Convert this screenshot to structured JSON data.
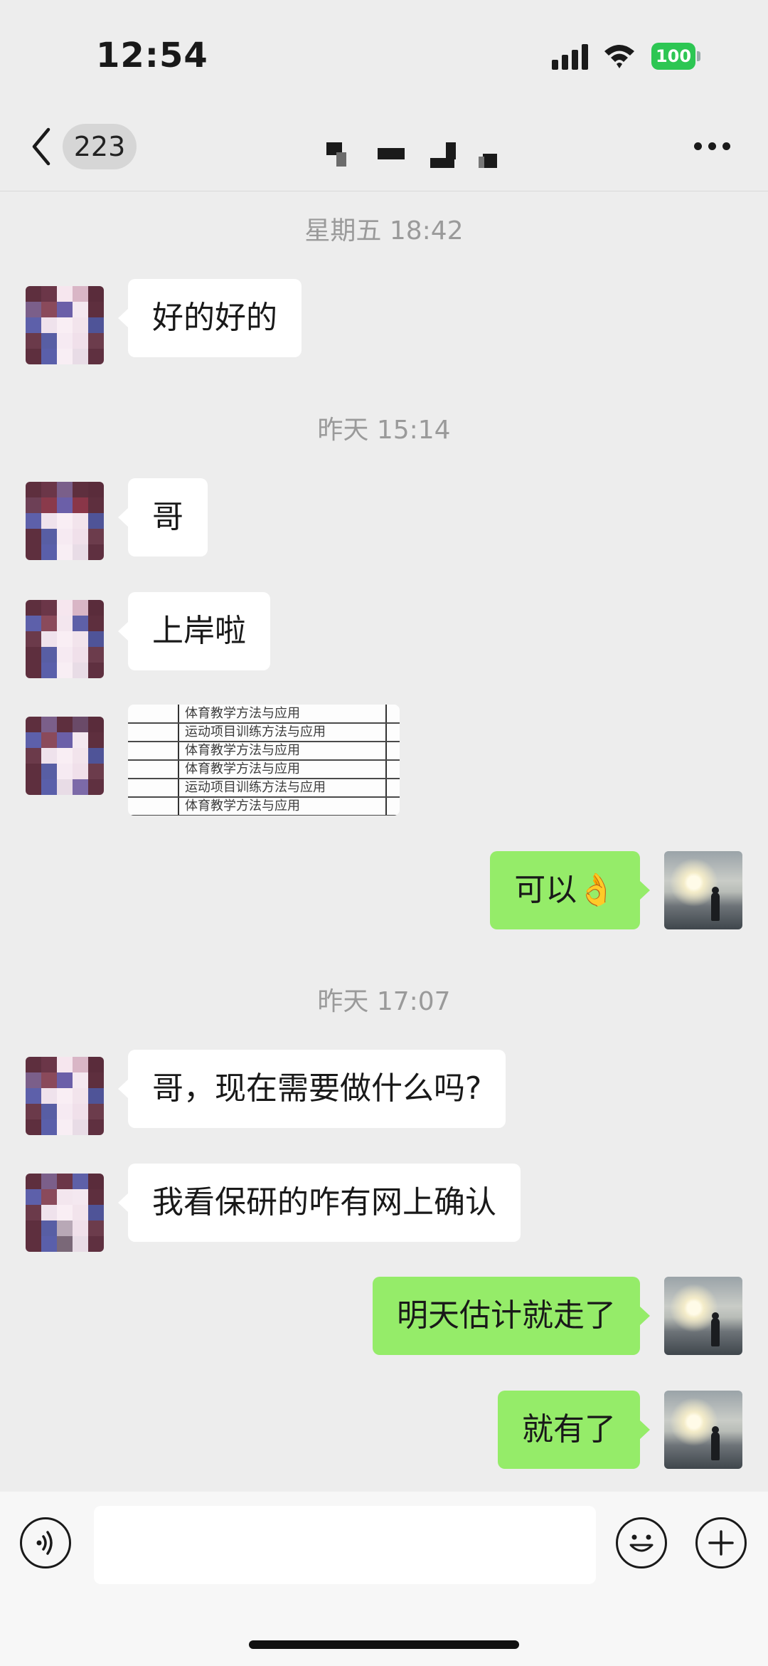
{
  "status_bar": {
    "time": "12:54",
    "battery": "100",
    "icons": [
      "signal-icon",
      "wifi-icon",
      "battery-icon"
    ]
  },
  "nav": {
    "unread_count": "223",
    "title": "",
    "icons": [
      "back-chevron-icon",
      "more-dots-icon"
    ]
  },
  "messages": [
    {
      "type": "timestamp",
      "text": "星期五 18:42"
    },
    {
      "type": "text",
      "sender": "friend",
      "text": "好的好的"
    },
    {
      "type": "timestamp",
      "text": "昨天 15:14"
    },
    {
      "type": "text",
      "sender": "friend",
      "text": "哥"
    },
    {
      "type": "text",
      "sender": "friend",
      "text": "上岸啦"
    },
    {
      "type": "image",
      "sender": "friend",
      "image_text": [
        "体育教学方法与应用",
        "运动项目训练方法与应用",
        "体育教学方法与应用",
        "体育教学方法与应用",
        "运动项目训练方法与应用",
        "体育教学方法与应用"
      ]
    },
    {
      "type": "text",
      "sender": "self",
      "text": "可以👌"
    },
    {
      "type": "timestamp",
      "text": "昨天 17:07"
    },
    {
      "type": "text",
      "sender": "friend",
      "text": "哥，现在需要做什么吗?"
    },
    {
      "type": "text",
      "sender": "friend",
      "text": "我看保研的咋有网上确认"
    },
    {
      "type": "text",
      "sender": "self",
      "text": "明天估计就走了"
    },
    {
      "type": "text",
      "sender": "self",
      "text": "就有了"
    }
  ],
  "input": {
    "value": "",
    "icons": [
      "voice-icon",
      "emoji-icon",
      "plus-icon"
    ]
  },
  "colors": {
    "background": "#ededed",
    "self_bubble": "#95ec69",
    "friend_bubble": "#ffffff",
    "timestamp": "#9a9a9a",
    "battery": "#2dc653"
  }
}
